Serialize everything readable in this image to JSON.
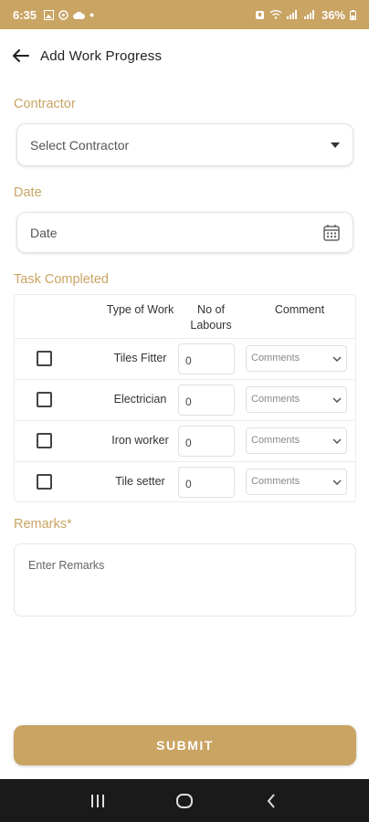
{
  "status_bar": {
    "time": "6:35",
    "battery": "36%",
    "left_icons": [
      "image-icon",
      "settings-icon",
      "cloud-icon",
      "dot-icon"
    ],
    "right_icons": [
      "alarm-icon",
      "wifi-icon",
      "signal-icon",
      "signal-icon",
      "battery-icon"
    ]
  },
  "app_bar": {
    "title": "Add Work Progress",
    "back_icon": "arrow-left-icon"
  },
  "contractor": {
    "label": "Contractor",
    "value": "Select Contractor",
    "icon": "caret-down-icon"
  },
  "date": {
    "label": "Date",
    "placeholder": "Date",
    "icon": "calendar-icon"
  },
  "task": {
    "label": "Task Completed",
    "headers": {
      "type_of_work": "Type of Work",
      "no_of_labours": "No of Labours",
      "comment": "Comment"
    },
    "rows": [
      {
        "work": "Tiles Fitter",
        "labours": "0",
        "comment": "Comments",
        "checked": false
      },
      {
        "work": "Electrician",
        "labours": "0",
        "comment": "Comments",
        "checked": false
      },
      {
        "work": "Iron worker",
        "labours": "0",
        "comment": "Comments",
        "checked": false
      },
      {
        "work": "Tile setter",
        "labours": "0",
        "comment": "Comments",
        "checked": false
      }
    ]
  },
  "remarks": {
    "label": "Remarks*",
    "placeholder": "Enter Remarks"
  },
  "submit_label": "SUBMIT",
  "nav_bar": {
    "icons": [
      "recent-apps-icon",
      "home-icon",
      "back-icon"
    ]
  },
  "colors": {
    "accent": "#c9a463",
    "navbar": "#1a1a1a"
  }
}
